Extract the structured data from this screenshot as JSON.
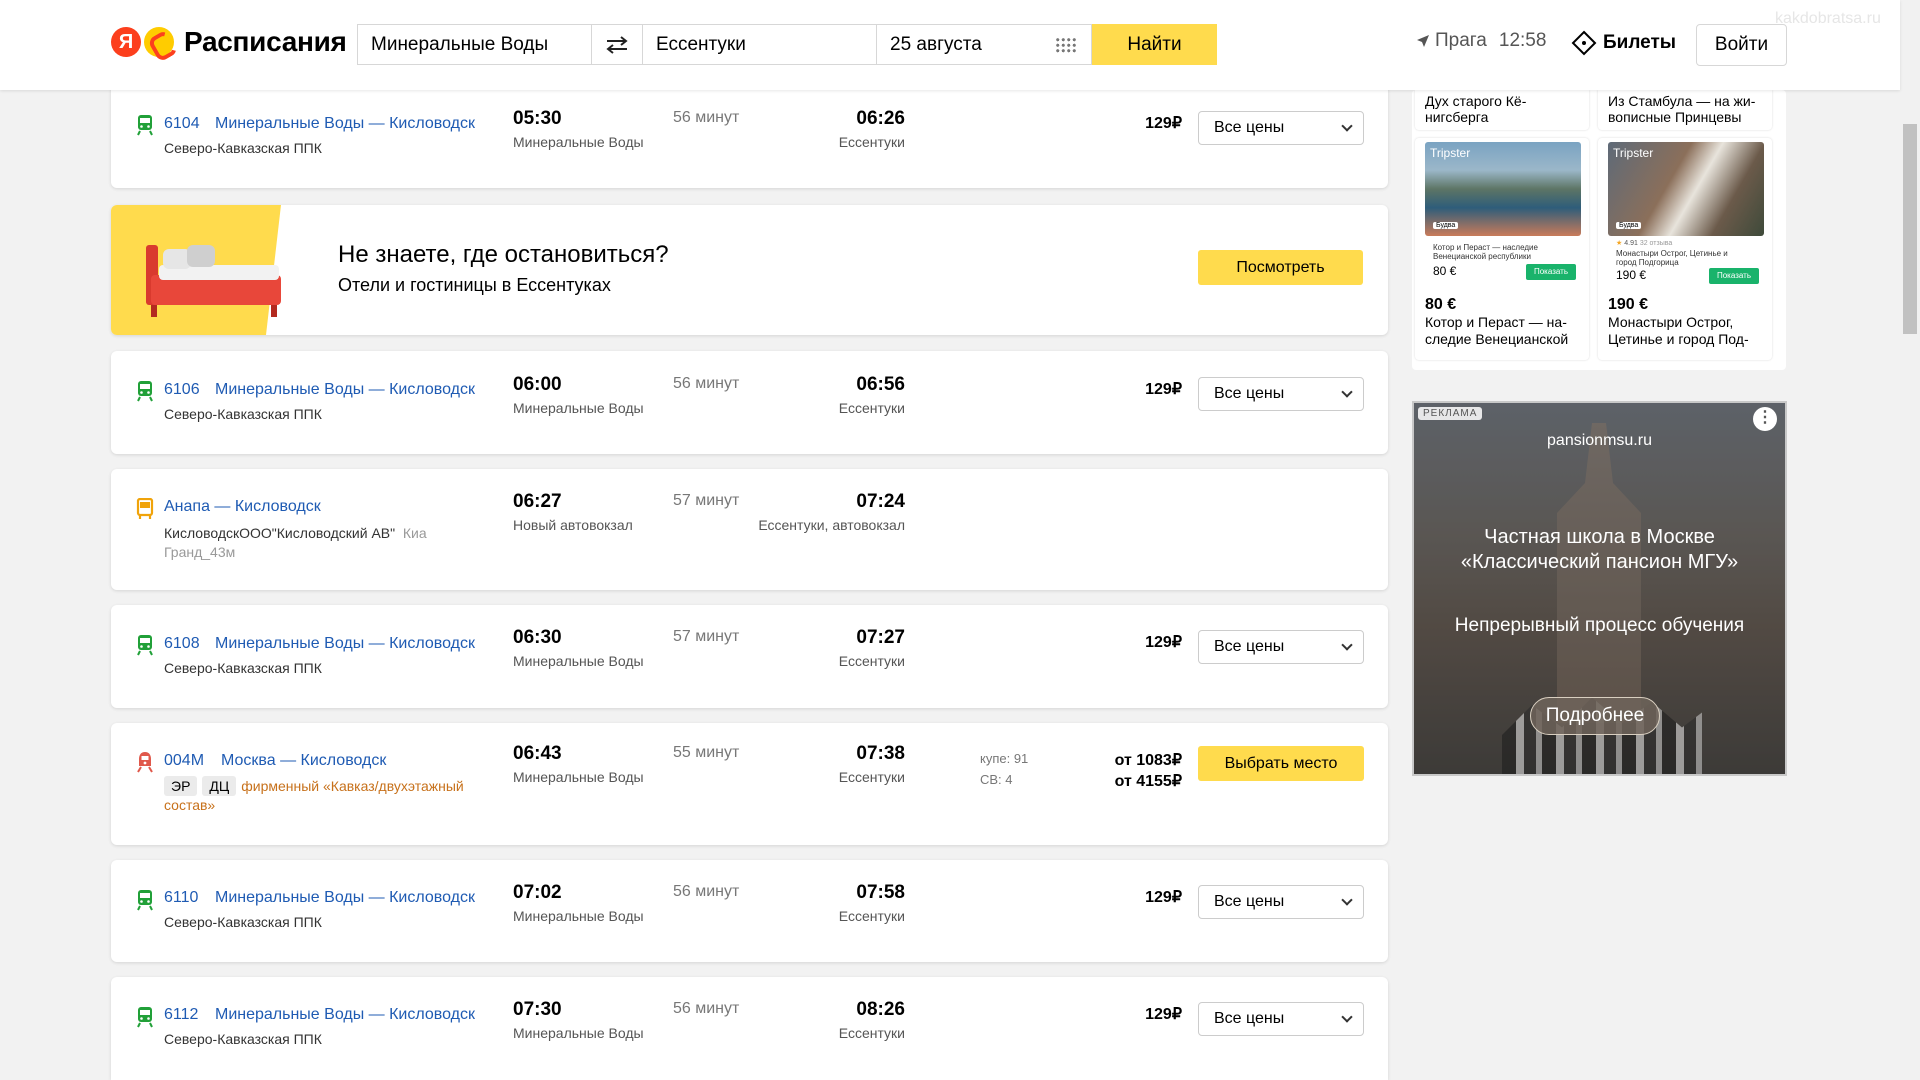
{
  "header": {
    "logo_text": "Расписания",
    "from": "Минеральные Воды",
    "to": "Ессентуки",
    "date": "25 августа",
    "search_button": "Найти",
    "location": "Прага",
    "time": "12:58",
    "tickets": "Билеты",
    "login": "Войти",
    "watermark": "kakdobratsa.ru"
  },
  "rows": [
    {
      "type": "train",
      "number": "6104",
      "route": "Минеральные Воды — Кисловодск",
      "carrier": "Северо-Кавказская ППК",
      "dep_time": "05:30",
      "dep_station": "Минеральные Воды",
      "duration": "56 минут",
      "arr_time": "06:26",
      "arr_station": "Ессентуки",
      "price": "129₽",
      "action": "Все цены"
    },
    {
      "type": "train",
      "number": "6106",
      "route": "Минеральные Воды — Кисловодск",
      "carrier": "Северо-Кавказская ППК",
      "dep_time": "06:00",
      "dep_station": "Минеральные Воды",
      "duration": "56 минут",
      "arr_time": "06:56",
      "arr_station": "Ессентуки",
      "price": "129₽",
      "action": "Все цены"
    },
    {
      "type": "bus",
      "route": "Анапа — Кисловодск",
      "carrier": "КисловодскООО\"Кисловодский АВ\"",
      "vehicle": "Киа Гранд_43м",
      "vehicle_a": "Киа",
      "vehicle_b": "Гранд_43м",
      "dep_time": "06:27",
      "dep_station": "Новый автовокзал",
      "duration": "57 минут",
      "arr_time": "07:24",
      "arr_station": "Ессентуки, автовокзал"
    },
    {
      "type": "train",
      "number": "6108",
      "route": "Минеральные Воды — Кисловодск",
      "carrier": "Северо-Кавказская ППК",
      "dep_time": "06:30",
      "dep_station": "Минеральные Воды",
      "duration": "57 минут",
      "arr_time": "07:27",
      "arr_station": "Ессентуки",
      "price": "129₽",
      "action": "Все цены"
    },
    {
      "type": "longtrain",
      "number": "004М",
      "route": "Москва — Кисловодск",
      "badges": [
        "ЭР",
        "ДЦ"
      ],
      "brand": "фирменный «Кавказ/двухэтажный состав»",
      "brand_a": "фирменный «Кавказ/двухэтажный",
      "brand_b": "состав»",
      "dep_time": "06:43",
      "dep_station": "Минеральные Воды",
      "duration": "55 минут",
      "arr_time": "07:38",
      "arr_station": "Ессентуки",
      "seats": [
        "купе: 91",
        "СВ: 4"
      ],
      "prices": [
        "от 1083₽",
        "от 4155₽"
      ],
      "action": "Выбрать место"
    },
    {
      "type": "train",
      "number": "6110",
      "route": "Минеральные Воды — Кисловодск",
      "carrier": "Северо-Кавказская ППК",
      "dep_time": "07:02",
      "dep_station": "Минеральные Воды",
      "duration": "56 минут",
      "arr_time": "07:58",
      "arr_station": "Ессентуки",
      "price": "129₽",
      "action": "Все цены"
    },
    {
      "type": "train",
      "number": "6112",
      "route": "Минеральные Воды — Кисловодск",
      "carrier": "Северо-Кавказская ППК",
      "dep_time": "07:30",
      "dep_station": "Минеральные Воды",
      "duration": "56 минут",
      "arr_time": "08:26",
      "arr_station": "Ессентуки",
      "price": "129₽",
      "action": "Все цены"
    }
  ],
  "hotel_promo": {
    "title": "Не знаете, где остановиться?",
    "subtitle": "Отели и гостиницы в Ессентуках",
    "button": "Посмотреть"
  },
  "tours": [
    {
      "top_title_a": "Дух старого Кё-",
      "top_title_b": "нигсберга",
      "brand": "Tripster",
      "tag": "Будва",
      "mini_title_a": "Котор и Пераст — наследие",
      "mini_title_b": "Венецианской республики",
      "mini_price": "80 €",
      "mini_button": "Показать",
      "price": "80 €",
      "title_a": "Котор и Пераст — на-",
      "title_b": "следие Венецианской"
    },
    {
      "top_title_a": "Из Стамбула — на жи-",
      "top_title_b": "вописные Принцевы",
      "brand": "Tripster",
      "tag": "Будва",
      "rating": "4.91",
      "reviews": "32 отзыва",
      "mini_title_a": "Монастыри Острог, Цетинье и",
      "mini_title_b": "город Подгорица",
      "mini_price": "190 €",
      "mini_button": "Показать",
      "price": "190 €",
      "title_a": "Монастыри Острог,",
      "title_b": "Цетинье и город Под-"
    }
  ],
  "ad": {
    "label": "РЕКЛАМА",
    "domain": "pansionmsu.ru",
    "headline_a": "Частная школа в Москве",
    "headline_b": "«Классический пансион МГУ»",
    "tagline": "Непрерывный процесс обучения",
    "button": "Подробнее"
  },
  "colors": {
    "accent": "#ffdb4d",
    "link": "#1f5bb3",
    "train_icon": "#21a038",
    "bus_icon": "#f0a30a",
    "longtrain_icon": "#e0584b"
  }
}
